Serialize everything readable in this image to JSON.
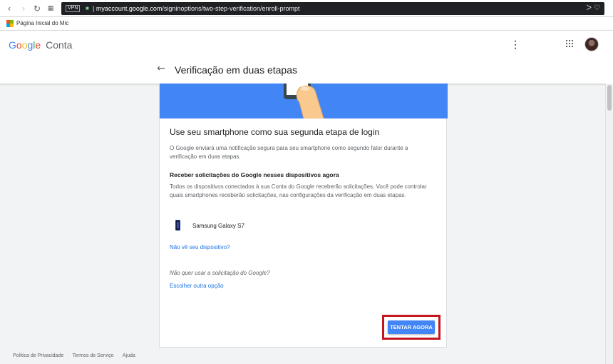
{
  "browser": {
    "back_icon": "chevron-left-icon",
    "forward_icon": "chevron-right-icon",
    "reload_icon": "reload-icon",
    "tabs_icon": "grid-icon",
    "vpn_label": "VPN",
    "url_sep": "|",
    "url_domain": "myaccount.google.com",
    "url_path": "/signinoptions/two-step-verification/enroll-prompt",
    "addr_icons": "ᐳ ♡"
  },
  "bookmarks": {
    "items": [
      {
        "label": "Página Inicial do Mic",
        "icon": "windows-logo-icon"
      }
    ]
  },
  "header": {
    "logo_g": "G",
    "logo_o1": "o",
    "logo_o2": "o",
    "logo_g2": "g",
    "logo_l": "l",
    "logo_e": "e",
    "logo_product": "Conta",
    "menu_icon": "more-vert-icon",
    "apps_icon": "apps-grid-icon",
    "avatar_icon": "avatar"
  },
  "page": {
    "title": "Verificação em duas etapas",
    "back_arrow": "←"
  },
  "card": {
    "title": "Use seu smartphone como sua segunda etapa de login",
    "description": "O Google enviará uma notificação segura para seu smartphone como segundo fator durante a verificação em duas etapas.",
    "section_title": "Receber solicitações do Google nesses dispositivos agora",
    "section_description": "Todos os dispositivos conectados à sua Conta do Google receberão solicitações. Você pode controlar quais smartphones receberão solicitações, nas configurações da verificação em duas etapas.",
    "device_name": "Samsung Galaxy S7",
    "missing_device_link": "Não vê seu dispositivo?",
    "alternative_question": "Não quer usar a solicitação do Google?",
    "other_option_link": "Escolher outra opção",
    "cta_label": "TENTAR AGORA"
  },
  "footer": {
    "privacy": "Política de Privacidade",
    "terms": "Termos de Serviço",
    "help": "Ajuda",
    "separator": "·"
  },
  "colors": {
    "accent": "#4285f4",
    "highlight_border": "#c4161c",
    "link": "#1a73e8"
  }
}
